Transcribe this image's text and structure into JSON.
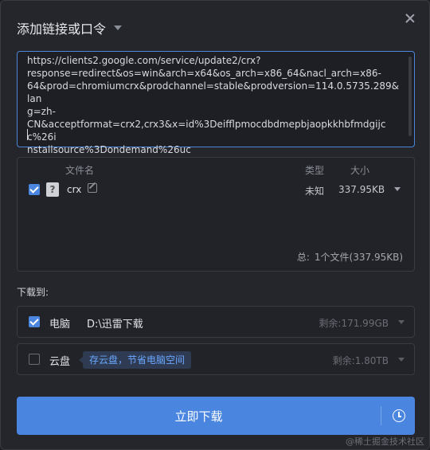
{
  "dialog": {
    "title": "添加链接或口令",
    "close_icon": "close-icon"
  },
  "url": {
    "value": "https://clients2.google.com/service/update2/crx?\nresponse=redirect&os=win&arch=x64&os_arch=x86_64&nacl_arch=x86-\n64&prod=chromiumcrx&prodchannel=stable&prodversion=114.0.5735.289&lan\ng=zh-\nCN&acceptformat=crx2,crx3&x=id%3Deifflpmocdbdmepbjaopkkhbfmdgijcc%26i\nnstallsource%3Dondemand%26uc"
  },
  "files": {
    "headers": {
      "name": "文件名",
      "type": "类型",
      "size": "大小"
    },
    "items": [
      {
        "checked": true,
        "icon": "unknown-file-icon",
        "name": "crx",
        "type": "未知",
        "size": "337.95KB"
      }
    ],
    "total_label": "总:",
    "total_value": "1个文件(337.95KB)"
  },
  "download_to": {
    "label": "下载到:",
    "pc": {
      "checked": true,
      "label": "电脑",
      "path": "D:\\迅雷下载",
      "free": "剩余:171.99GB"
    },
    "cloud": {
      "checked": false,
      "label": "云盘",
      "badge": "存云盘，节省电脑空间",
      "free": "剩余:1.80TB"
    }
  },
  "actions": {
    "download_now": "立即下载",
    "schedule_icon": "clock-icon"
  },
  "watermark": "@稀土掘金技术社区",
  "colors": {
    "accent": "#4a86e0",
    "background": "#25262b"
  }
}
